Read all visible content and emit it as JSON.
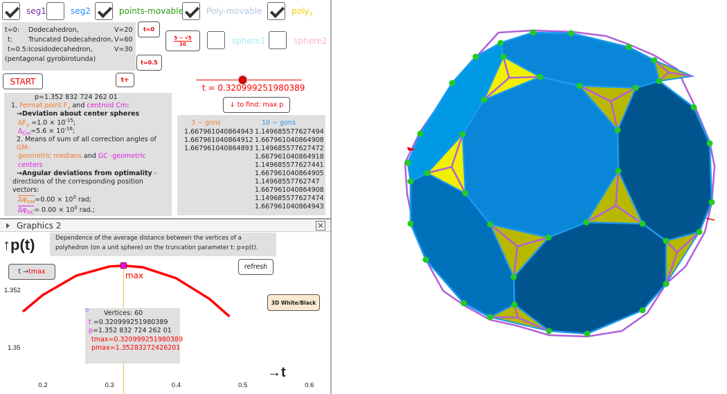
{
  "checkboxes": [
    {
      "label": "seg1",
      "checked": true,
      "color": "#7b2fa0"
    },
    {
      "label": "seg2",
      "checked": false,
      "color": "#1e90ff"
    },
    {
      "label": "points-movable",
      "checked": true,
      "color": "#2e9a10"
    },
    {
      "label": "Poly-movable",
      "checked": true,
      "color": "#b0c8e0"
    },
    {
      "label": "poly",
      "sub": "3",
      "checked": true,
      "color": "#f0d000"
    },
    {
      "label": "sphere1",
      "checked": false,
      "color": "#a8e8f0"
    },
    {
      "label": "sphere2",
      "checked": false,
      "color": "#f8b8c8"
    }
  ],
  "info": {
    "rows": [
      [
        "t=0:",
        "Dodecahedron,",
        "V=20"
      ],
      [
        "t:",
        "Truncated Dodecahedron,",
        "V=60"
      ],
      [
        "t=0.5:",
        "Icosidodecahedron,",
        "V=30"
      ]
    ],
    "note": "(pentagonal gyrobirotunda)"
  },
  "buttons": {
    "t0": "t=0",
    "t05": "t=0.5",
    "frac_num": "5 − √5",
    "frac_den": "10",
    "start": "START",
    "tplus": "t+",
    "find": "↓ to find: max p",
    "tmax_t": "t → ",
    "tmax_red": "tmax",
    "refresh": "refresh",
    "white_black": "3D White/Black"
  },
  "slider": {
    "label": "t = 0.320999251980389",
    "value": 0.320999251980389,
    "min": 0,
    "max": 0.5
  },
  "deviation": {
    "p": "p=1.352 832 724 262 01",
    "l1a": "1.",
    "l1b": "Fermat point  F",
    "l1c": "o",
    "l1d": " and ",
    "l1e": "centroid Cm",
    ":": ":",
    "l2": "→Deviation about center spheres",
    "dF": "ΔF",
    "dFsub": "o",
    "dFval": " =1.0 × 10",
    "dFexp": "-15",
    "semi": ";",
    "dC": "Δ",
    "dCsub": "Cm",
    "dCval": "=5.6 × 10",
    "dCexp": "-16",
    "l3a": "2. Means of sum of all correction angles of ",
    "l3b": "GM-",
    "l3c": "geometric medians",
    "l3d": " and ",
    "l3e": "GC",
    "l3f": " -geometric centers",
    ".": ".",
    "l4": "→Angular deviations from optimality",
    "l4b": " -",
    "l5": "directions of the corresponding position vectors:",
    "gm": "Δφ",
    "gmsub": "GM",
    "gmval": "=0.00 × 10",
    "gmexp": "0",
    "gmunit": "  rad;",
    "gc": "Δφ",
    "gcsub": "GC",
    "gcval": "= 0.00 × 10",
    "gcexp": "0",
    "gcunit": " rad.;"
  },
  "gons": {
    "h3": "3 − gons",
    "h10": "10 − gons",
    "col3": [
      "1.667961040864943",
      "1.667961040864912",
      "1.667961040864893"
    ],
    "col10": [
      "1.149685577627494",
      "1.667961040864908",
      "1.149685577627472",
      "1.667961040864918",
      "1.149685577627441",
      "1.667961040864905",
      "1.14968557762747",
      "1.667961040864908",
      "1.149685577627474",
      "1.667961040864943"
    ]
  },
  "graphics2": {
    "title": "Graphics 2",
    "desc1": "Dependence of the average distance between the vertices of a",
    "desc2": "polyhedron (on a unit sphere) on the truncation parameter t: p=p(t).",
    "ylabel": "↑p(t)",
    "xlabel": "→t",
    "max_label": "max",
    "box": {
      "v": "Vertices: 60",
      "t1": "t",
      "t2": " =0.320999251980389",
      "p1": "p",
      "p2": "=1.352 832 724 262 01",
      "tmax": "tmax=0.320999251980389",
      "pmax": "pmax=1.35283272426201"
    }
  },
  "chart_data": {
    "type": "line",
    "xlabel": "→t",
    "ylabel": "↑p(t)",
    "xticks": [
      "0.2",
      "0.3",
      "0.4",
      "0.5",
      "0.6"
    ],
    "yticks": [
      "1.352",
      "1.35"
    ],
    "xlim": [
      0.145,
      0.615
    ],
    "ylim": [
      1.3493,
      1.3535
    ],
    "series": [
      {
        "color": "#ff0000",
        "x": [
          0.17,
          0.2,
          0.25,
          0.3,
          0.321,
          0.35,
          0.4,
          0.45,
          0.48
        ],
        "y": [
          1.35123,
          1.35181,
          1.35248,
          1.3528,
          1.35283,
          1.35277,
          1.35239,
          1.35167,
          1.35106
        ]
      }
    ],
    "max_point": {
      "x": 0.320999251980389,
      "y": 1.35283272426201
    }
  },
  "colors": {
    "face_main": "#0a86d8",
    "face_light": "#0099e6",
    "face_dark": "#00558e",
    "tri_bright": "#f0f000",
    "tri_olive": "#b8b800",
    "wire": "#b060d8",
    "vertex": "#22cc22"
  }
}
